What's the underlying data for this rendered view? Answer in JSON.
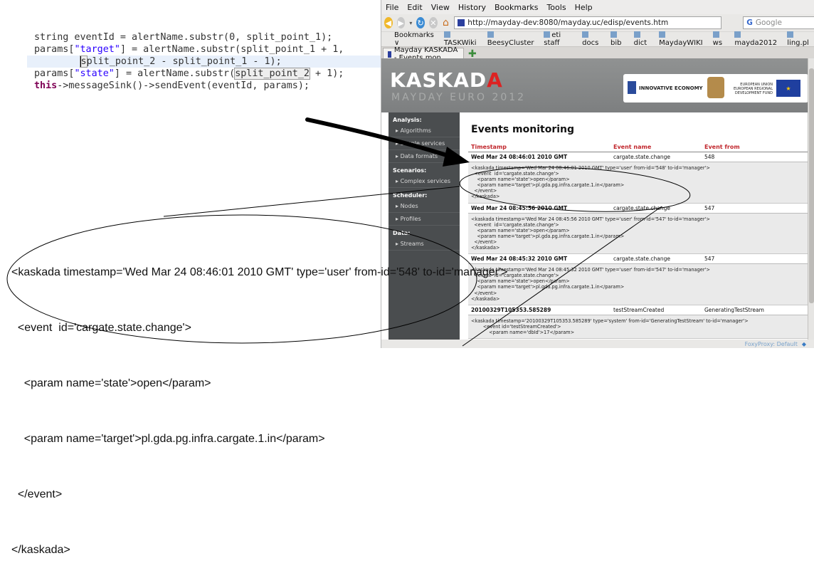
{
  "code": {
    "line1": {
      "a": "string",
      "b": " eventId = alertName.substr(0, split_point_1);"
    },
    "line2": {
      "a": "params[",
      "s": "\"target\"",
      "b": "] = alertName.substr(split_point_1 + 1,"
    },
    "line3": {
      "pad": "        ",
      "b1": "s",
      "b2": "plit_point_2",
      "c": " - split_point_1 - 1);"
    },
    "line4": {
      "a": "params[",
      "s": "\"state\"",
      "b": "] = alertName.substr(",
      "box": "split_point_2",
      "c": " + 1);"
    },
    "line5": {
      "kw": "this",
      "b": "->messageSink()->sendEvent(eventId, params);"
    }
  },
  "browser": {
    "menu": [
      "File",
      "Edit",
      "View",
      "History",
      "Bookmarks",
      "Tools",
      "Help"
    ],
    "url": "http://mayday-dev:8080/mayday.uc/edisp/events.htm",
    "search_placeholder": "Google",
    "bookmarks_label": "Bookmarks ∨",
    "bookmarks": [
      "TASKWiki",
      "BeesyCluster",
      "eti staff",
      "docs",
      "bib",
      "dict",
      "MaydayWIKI",
      "ws",
      "mayda2012",
      "ling.pl"
    ],
    "tab_title": "Mayday KASKADA - Events mon...",
    "status": "FoxyProxy: Default"
  },
  "site": {
    "logo_prefix": "KASKAD",
    "logo_suffix": "A",
    "logo_sub": "MAYDAY EURO 2012",
    "sponsor_ie": "INNOVATIVE ECONOMY",
    "sponsor_eu": "EUROPEAN UNION EUROPEAN REGIONAL DEVELOPMENT FUND",
    "sidebar": [
      {
        "head": "Analysis:",
        "items": [
          "Algorithms",
          "Simple services",
          "Data formats"
        ]
      },
      {
        "head": "Scenarios:",
        "items": [
          "Complex services"
        ]
      },
      {
        "head": "Scheduler:",
        "items": [
          "Nodes",
          "Profiles"
        ]
      },
      {
        "head": "Data:",
        "items": [
          "Streams"
        ]
      }
    ],
    "page_title": "Events monitoring",
    "columns": {
      "ts": "Timestamp",
      "name": "Event name",
      "from": "Event from"
    },
    "events": [
      {
        "ts": "Wed Mar 24 08:46:01 2010 GMT",
        "name": "cargate.state.change",
        "from": "548",
        "xml": "<kaskada timestamp='Wed Mar 24 08:46:01 2010 GMT' type='user' from-id='548' to-id='manager'>\n  <event  id='cargate.state.change'>\n    <param name='state'>open</param>\n    <param name='target'>pl.gda.pg.infra.cargate.1.in</param>\n  </event>\n</kaskada>"
      },
      {
        "ts": "Wed Mar 24 08:45:56 2010 GMT",
        "name": "cargate.state.change",
        "from": "547",
        "xml": "<kaskada timestamp='Wed Mar 24 08:45:56 2010 GMT' type='user' from-id='547' to-id='manager'>\n  <event  id='cargate.state.change'>\n    <param name='state'>open</param>\n    <param name='target'>pl.gda.pg.infra.cargate.1.in</param>\n  </event>\n</kaskada>"
      },
      {
        "ts": "Wed Mar 24 08:45:32 2010 GMT",
        "name": "cargate.state.change",
        "from": "547",
        "xml": "<kaskada timestamp='Wed Mar 24 08:45:32 2010 GMT' type='user' from-id='547' to-id='manager'>\n  <event  id='cargate.state.change'>\n    <param name='state'>open</param>\n    <param name='target'>pl.gda.pg.infra.cargate.1.in</param>\n  </event>\n</kaskada>"
      },
      {
        "ts": "20100329T105353.585289",
        "name": "testStreamCreated",
        "from": "GeneratingTestStream",
        "xml": "<kaskada timestamp='20100329T105353.585289' type='system' from-id='GeneratingTestStream' to-id='manager'>\n        <event id='testStreamCreated'>\n            <param name='dbId'>17</param>"
      }
    ]
  },
  "zoom": {
    "lines": [
      "<kaskada timestamp='Wed Mar 24 08:46:01 2010 GMT' type='user' from-id='548' to-id='manager'>",
      "  <event  id='cargate.state.change'>",
      "    <param name='state'>open</param>",
      "    <param name='target'>pl.gda.pg.infra.cargate.1.in</param>",
      "  </event>",
      "</kaskada>"
    ]
  }
}
